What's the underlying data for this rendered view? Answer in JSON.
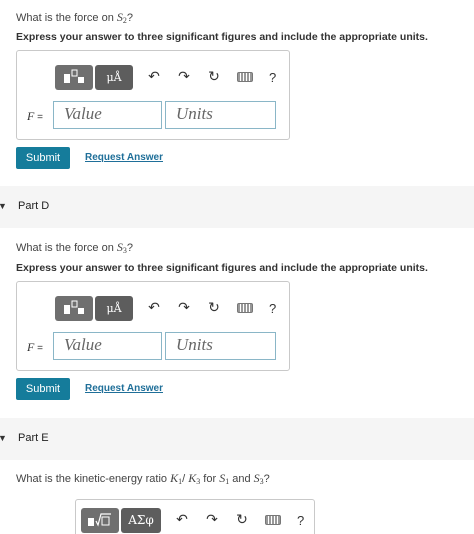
{
  "partC": {
    "question_prefix": "What is the force on ",
    "question_var": "S",
    "question_sub": "2",
    "question_suffix": "?",
    "instruction": "Express your answer to three significant figures and include the appropriate units.",
    "var_label": "F",
    "eq": " =",
    "value_placeholder": "Value",
    "units_placeholder": "Units",
    "submit": "Submit",
    "request": "Request Answer"
  },
  "partD": {
    "title": "Part D",
    "question_prefix": "What is the force on ",
    "question_var": "S",
    "question_sub": "3",
    "question_suffix": "?",
    "instruction": "Express your answer to three significant figures and include the appropriate units.",
    "var_label": "F",
    "eq": " =",
    "value_placeholder": "Value",
    "units_placeholder": "Units",
    "submit": "Submit",
    "request": "Request Answer"
  },
  "partE": {
    "title": "Part E",
    "question_prefix": "What is the kinetic-energy ratio ",
    "k1": "K",
    "k1_sub": "1",
    "slash": "/ ",
    "k3": "K",
    "k3_sub": "3",
    "mid": " for ",
    "s1": "S",
    "s1_sub": "1",
    "and": " and ",
    "s3": "S",
    "s3_sub": "3",
    "suffix": "?",
    "greek_button": "ΑΣφ"
  },
  "toolbar": {
    "units_glyph": "μÅ",
    "undo": "↶",
    "redo": "↷",
    "reset": "↻",
    "help": "?"
  },
  "icons": [
    "templates-icon",
    "units-icon",
    "undo-icon",
    "redo-icon",
    "reset-icon",
    "keyboard-icon",
    "help-icon",
    "caret-down-icon",
    "greek-letters-icon",
    "radical-template-icon"
  ],
  "colors": {
    "submit": "#157c9b",
    "link": "#1f6f99",
    "field_border": "#8ab6c7",
    "band": "#f5f5f5"
  }
}
